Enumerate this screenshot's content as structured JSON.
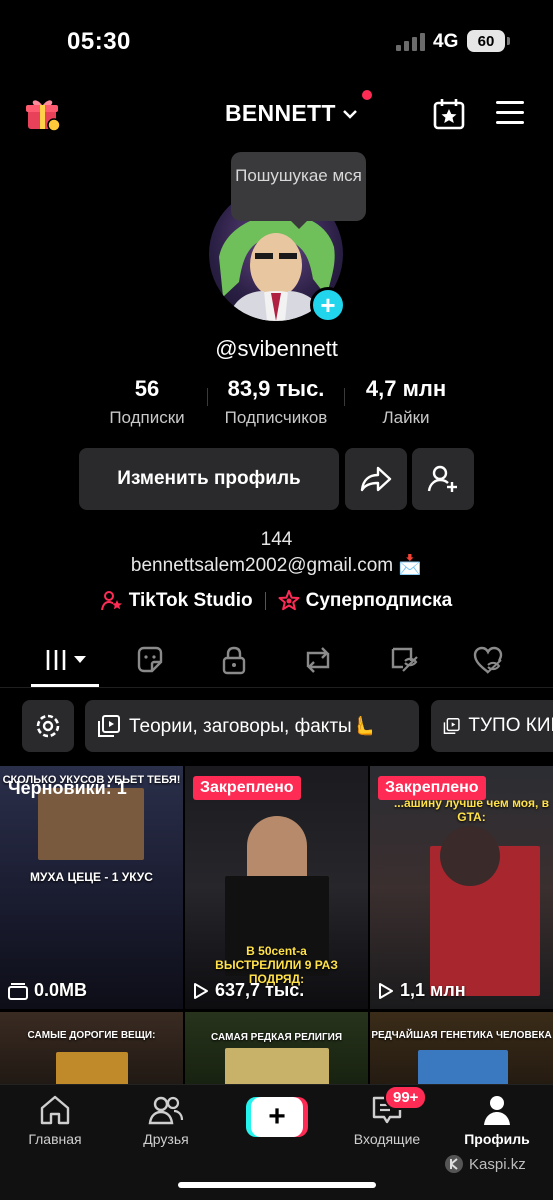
{
  "status_bar": {
    "time": "05:30",
    "network": "4G",
    "battery": "60"
  },
  "header": {
    "username": "BENNETT"
  },
  "profile": {
    "tooltip": "Пошушукае мся",
    "handle": "@svibennett",
    "stats": [
      {
        "value": "56",
        "label": "Подписки"
      },
      {
        "value": "83,9 тыс.",
        "label": "Подписчиков"
      },
      {
        "value": "4,7 млн",
        "label": "Лайки"
      }
    ],
    "edit_button": "Изменить профиль",
    "bio_line1": "144",
    "bio_line2": "bennettsalem2002@gmail.com 📩",
    "studio_link": "TikTok Studio",
    "super_link": "Суперподписка"
  },
  "playlists": [
    {
      "label": "Теории, заговоры, факты🫷"
    },
    {
      "label": "ТУПО КИНО"
    }
  ],
  "videos": [
    {
      "drafts": "Черновики: 1",
      "caption_top": "СКОЛЬКО УКУСОВ УБЬЕТ ТЕБЯ!",
      "caption_bottom": "МУХА ЦЕЦЕ - 1 УКУС",
      "views": "0.0MB"
    },
    {
      "pinned": "Закреплено",
      "caption_bottom": "В 50cent-а ВЫСТРЕЛИЛИ 9 РАЗ ПОДРЯД:",
      "views": "637,7 тыс."
    },
    {
      "pinned": "Закреплено",
      "caption_top": "...ашину лучше чем моя, в GTA:",
      "views": "1,1 млн"
    },
    {
      "caption_top": "САМЫЕ ДОРОГИЕ ВЕЩИ:"
    },
    {
      "caption_top": "САМАЯ РЕДКАЯ РЕЛИГИЯ"
    },
    {
      "caption_top": "РЕДЧАЙШАЯ ГЕНЕТИКА ЧЕЛОВЕКА"
    }
  ],
  "nav": {
    "home": "Главная",
    "friends": "Друзья",
    "inbox": "Входящие",
    "inbox_badge": "99+",
    "profile": "Профиль"
  },
  "watermark": "Kaspi.kz",
  "colors": {
    "accent": "#fe2c55",
    "cyan": "#20d5ec",
    "surface": "#2a2a2c"
  }
}
